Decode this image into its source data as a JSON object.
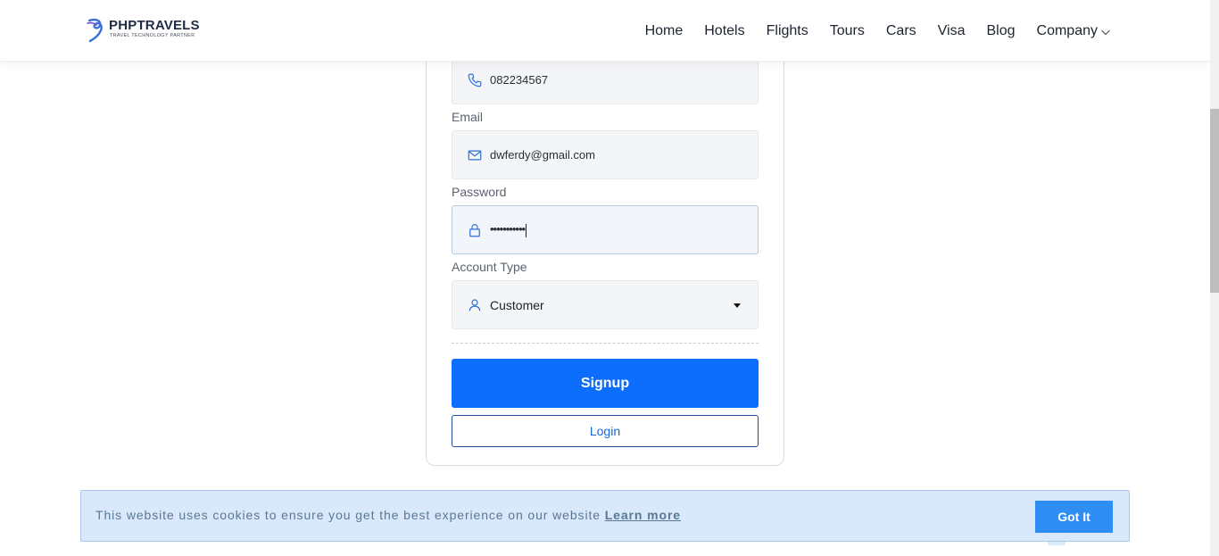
{
  "header": {
    "brand_name": "PHPTRAVELS",
    "brand_tagline": "TRAVEL TECHNOLOGY PARTNER",
    "nav": [
      {
        "label": "Home"
      },
      {
        "label": "Hotels"
      },
      {
        "label": "Flights"
      },
      {
        "label": "Tours"
      },
      {
        "label": "Cars"
      },
      {
        "label": "Visa"
      },
      {
        "label": "Blog"
      },
      {
        "label": "Company",
        "icon": "chevron-down-icon"
      }
    ]
  },
  "form": {
    "phone": {
      "value": "082234567",
      "icon": "phone-icon"
    },
    "email": {
      "label": "Email",
      "value": "dwferdy@gmail.com",
      "icon": "envelope-icon"
    },
    "password": {
      "label": "Password",
      "value": "•••••••••••",
      "icon": "lock-icon"
    },
    "account_type": {
      "label": "Account Type",
      "value": "Customer",
      "icon": "user-icon"
    },
    "signup_label": "Signup",
    "login_label": "Login"
  },
  "cookie": {
    "message": "This website uses cookies to ensure you get the best experience on our website",
    "link_label": "Learn more",
    "button_label": "Got It"
  },
  "colors": {
    "primary": "#0d6efd",
    "cookie_bg": "#d9e8fb",
    "cookie_button": "#2f8ef4",
    "icon_blue": "#2f6fd6"
  }
}
